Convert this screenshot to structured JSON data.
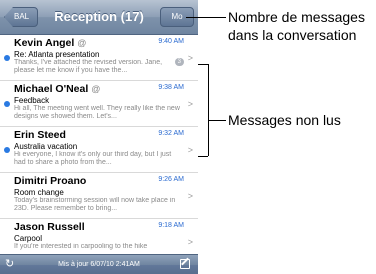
{
  "navbar": {
    "back_label": "BAL",
    "title": "Reception (17)",
    "edit_label": "Mo"
  },
  "messages": [
    {
      "sender": "Kevin Angel",
      "attachment": "@",
      "time": "9:40 AM",
      "subject": "Re: Atlanta presentation",
      "preview": "Thanks, I've attached the revised version. Jane, please let me know if you have the...",
      "unread": true,
      "thread_count": "3"
    },
    {
      "sender": "Michael O'Neal",
      "attachment": "@",
      "time": "9:38 AM",
      "subject": "Feedback",
      "preview": "Hi all, The meeting went well. They really like the new designs we showed them. Let's...",
      "unread": true,
      "thread_count": ""
    },
    {
      "sender": "Erin Steed",
      "attachment": "",
      "time": "9:32 AM",
      "subject": "Australia vacation",
      "preview": "Hi everyone, I know it's only our third day, but I just had to share a photo from the...",
      "unread": true,
      "thread_count": ""
    },
    {
      "sender": "Dimitri Proano",
      "attachment": "",
      "time": "9:26 AM",
      "subject": "Room change",
      "preview": "Today's brainstorming session will now take place in 23D. Please remember to bring...",
      "unread": false,
      "thread_count": ""
    },
    {
      "sender": "Jason Russell",
      "attachment": "",
      "time": "9:18 AM",
      "subject": "Carpool",
      "preview": "If you're interested in carpooling to the hike",
      "unread": false,
      "thread_count": ""
    }
  ],
  "toolbar": {
    "updated": "Mis à jour 6/07/10 2:41AM"
  },
  "callouts": {
    "thread_count": "Nombre de messages dans la conversation",
    "unread": "Messages non lus"
  },
  "colors": {
    "unread_dot": "#2a7ae2",
    "time": "#2a6ad0",
    "navbar": "#7e92ab"
  }
}
